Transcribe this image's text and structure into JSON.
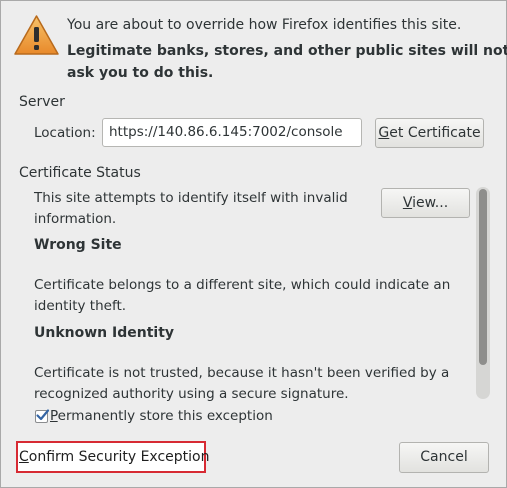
{
  "header": {
    "icon": "warning-icon",
    "line1": "You are about to override how Firefox identifies this site.",
    "line2": "Legitimate banks, stores, and other public sites will not",
    "line3": "ask you to do this."
  },
  "server": {
    "heading": "Server",
    "location_label": "Location:",
    "location_value": "https://140.86.6.145:7002/console",
    "get_certificate": {
      "mnemonic": "G",
      "rest": "et Certificate"
    }
  },
  "certificate_status": {
    "heading": "Certificate Status",
    "intro_line1": "This site attempts to identify itself with invalid",
    "intro_line2": "information.",
    "view_button": {
      "mnemonic": "V",
      "rest": "iew..."
    },
    "wrong_site_heading": "Wrong Site",
    "wrong_site_line1": "Certificate belongs to a different site, which could indicate an",
    "wrong_site_line2": "identity theft.",
    "unknown_identity_heading": "Unknown Identity",
    "unknown_identity_line1": "Certificate is not trusted, because it hasn't been verified by a",
    "unknown_identity_line2": "recognized authority using a secure signature."
  },
  "permanent_store": {
    "checked": true,
    "mnemonic": "P",
    "rest": "ermanently store this exception"
  },
  "footer": {
    "confirm": {
      "mnemonic": "C",
      "rest": "onfirm Security Exception"
    },
    "cancel_label": "Cancel"
  },
  "colors": {
    "dialog_bg": "#ededed",
    "highlight_border": "#d72a33",
    "warning_fill": "#f0a030"
  }
}
